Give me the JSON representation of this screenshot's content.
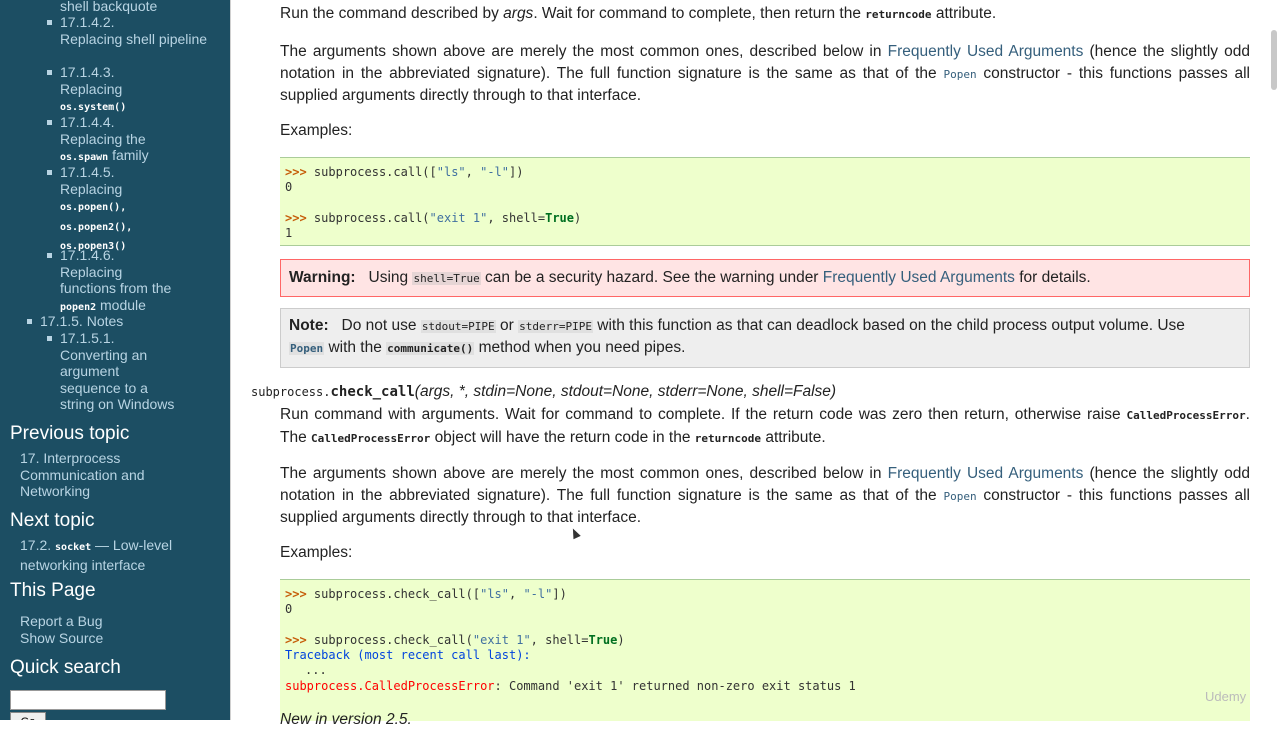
{
  "sidebar": {
    "toc": [
      {
        "text": "shell backquote"
      },
      {
        "num": "17.1.4.2.",
        "text": "Replacing shell pipeline"
      },
      {
        "num": "17.1.4.3.",
        "text": "Replacing",
        "code": "os.system()"
      },
      {
        "num": "17.1.4.4.",
        "text": "Replacing the",
        "code": "os.spawn",
        "tail": "family"
      },
      {
        "num": "17.1.4.5.",
        "text": "Replacing",
        "codes": [
          "os.popen(),",
          "os.popen2(),",
          "os.popen3()"
        ]
      },
      {
        "num": "17.1.4.6.",
        "text": "Replacing functions from the",
        "code": "popen2",
        "tail": "module"
      },
      {
        "num": "17.1.5.",
        "text": "Notes"
      },
      {
        "num": "17.1.5.1.",
        "text": "Converting an argument sequence to a string on Windows"
      }
    ],
    "previous_heading": "Previous topic",
    "previous_link": "17. Interprocess Communication and Networking",
    "next_heading": "Next topic",
    "next_link_num": "17.2.",
    "next_link_code": "socket",
    "next_link_text": "— Low-level networking interface",
    "this_page_heading": "This Page",
    "report_bug": "Report a Bug",
    "show_source": "Show Source",
    "quick_search_heading": "Quick search",
    "search_value": "",
    "go_label": "Go"
  },
  "main": {
    "call_desc_prefix": "Run the command described by",
    "call_desc_args": "args",
    "call_desc_mid": ". Wait for command to complete, then return the",
    "call_desc_code": "returncode",
    "call_desc_suffix": "attribute.",
    "args_para1_a": "The arguments shown above are merely the most common ones, described below in",
    "args_link": "Frequently Used Arguments",
    "args_para1_b": "(hence the slightly odd notation in the abbreviated signature). The full function signature is the same as that of the",
    "args_popen": "Popen",
    "args_para1_c": "constructor - this functions passes all supplied arguments directly through to that interface.",
    "examples_label": "Examples:",
    "call_examples": {
      "prompt": ">>>",
      "line1_fn": "subprocess.call([",
      "line1_s1": "\"ls\"",
      "line1_sep": ", ",
      "line1_s2": "\"-l\"",
      "line1_end": "])",
      "out1": "0",
      "line2_fn": "subprocess.call(",
      "line2_s1": "\"exit 1\"",
      "line2_mid": ", shell=",
      "line2_kw": "True",
      "line2_end": ")",
      "out2": "1"
    },
    "warning": {
      "title": "Warning:",
      "text_a": "Using",
      "code": "shell=True",
      "text_b": "can be a security hazard. See the warning under",
      "link": "Frequently Used Arguments",
      "text_c": "for details."
    },
    "note": {
      "title": "Note:",
      "text_a": "Do not use",
      "code1": "stdout=PIPE",
      "text_b": "or",
      "code2": "stderr=PIPE",
      "text_c": "with this function as that can deadlock based on the child process output volume. Use",
      "popen": "Popen",
      "text_d": "with the",
      "communicate": "communicate()",
      "text_e": "method when you need pipes."
    },
    "signature": {
      "module": "subprocess.",
      "name": "check_call",
      "params": "(args, *, stdin=None, stdout=None, stderr=None, shell=False)"
    },
    "check_desc_a": "Run command with arguments. Wait for command to complete. If the return code was zero then return, otherwise raise",
    "check_err_code": "CalledProcessError",
    "check_desc_b": ". The",
    "check_desc_c": "object will have the return code in the",
    "check_returncode": "returncode",
    "check_desc_d": "attribute.",
    "check_examples": {
      "line1_fn": "subprocess.check_call([",
      "out1": "0",
      "line2_fn": "subprocess.check_call(",
      "tb1": "Traceback (most recent call last):",
      "tb2": "...",
      "tb3_err": "subprocess.CalledProcessError",
      "tb3_msg": ": Command 'exit 1' returned non-zero exit status 1"
    },
    "new_version": "New in version 2.5."
  },
  "watermark": "Udemy"
}
